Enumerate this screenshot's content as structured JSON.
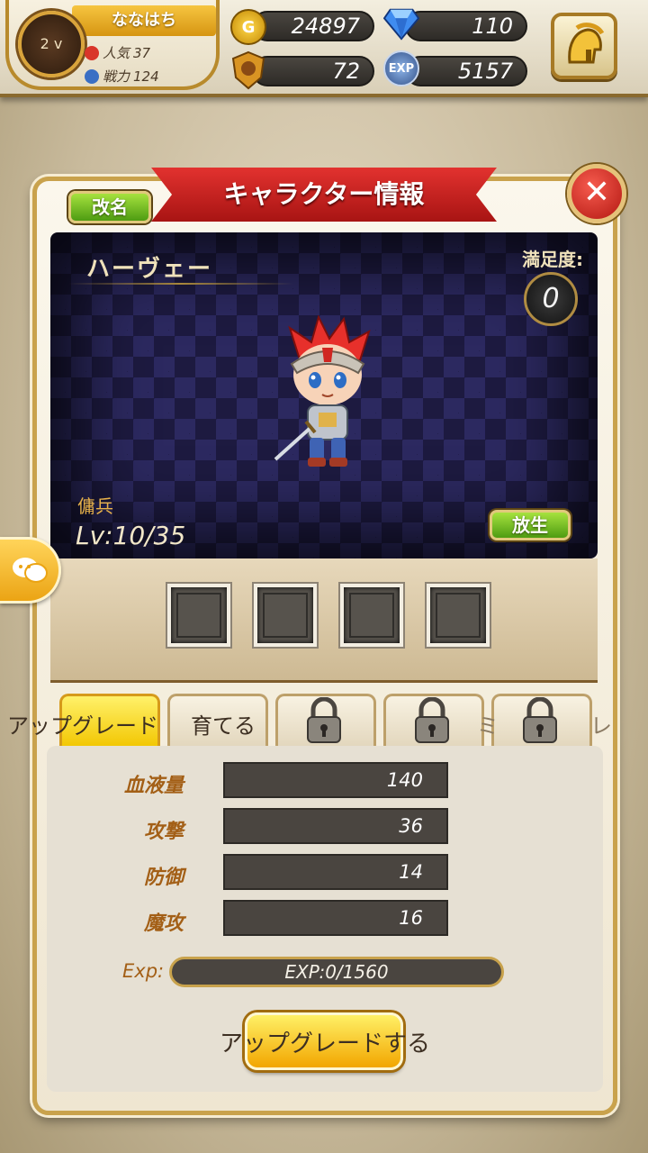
{
  "player": {
    "name": "ななはち",
    "level_text": "2 v",
    "popularity_label": "人気",
    "popularity_value": "37",
    "power_label": "戦力",
    "power_value": "124"
  },
  "resources": {
    "gold": "24897",
    "gems": "110",
    "medals": "72",
    "exp": "5157",
    "exp_icon_label": "EXP",
    "gold_icon_label": "G"
  },
  "panel": {
    "title": "キャラクター情報",
    "rename_label": "改名",
    "release_label": "放生",
    "close_glyph": "✕"
  },
  "character": {
    "name": "ハーヴェー",
    "satisfaction_label": "満足度:",
    "satisfaction_value": "0",
    "role": "傭兵",
    "level": "Lv:10/35"
  },
  "tabs": [
    {
      "label": "アップグレード",
      "active": true,
      "locked": false
    },
    {
      "label": "育てる",
      "active": false,
      "locked": false
    },
    {
      "label": "",
      "active": false,
      "locked": true
    },
    {
      "label": "",
      "active": false,
      "locked": true
    },
    {
      "label": "",
      "active": false,
      "locked": true
    }
  ],
  "tab_overflow_text": {
    "left_partial": "レ",
    "mid_partial": "ミ"
  },
  "stats": [
    {
      "name": "血液量",
      "value": "140"
    },
    {
      "name": "攻撃",
      "value": "36"
    },
    {
      "name": "防御",
      "value": "14"
    },
    {
      "name": "魔攻",
      "value": "16"
    }
  ],
  "exp": {
    "label": "Exp:",
    "value_text": "EXP:0/1560",
    "fraction": 0.0
  },
  "upgrade_button_label": "アップグレードする",
  "colors": {
    "gold": "#f2b418",
    "ribbon_red": "#c81e1c",
    "stat_orange": "#a35f16",
    "green_button": "#6cbb1f"
  }
}
